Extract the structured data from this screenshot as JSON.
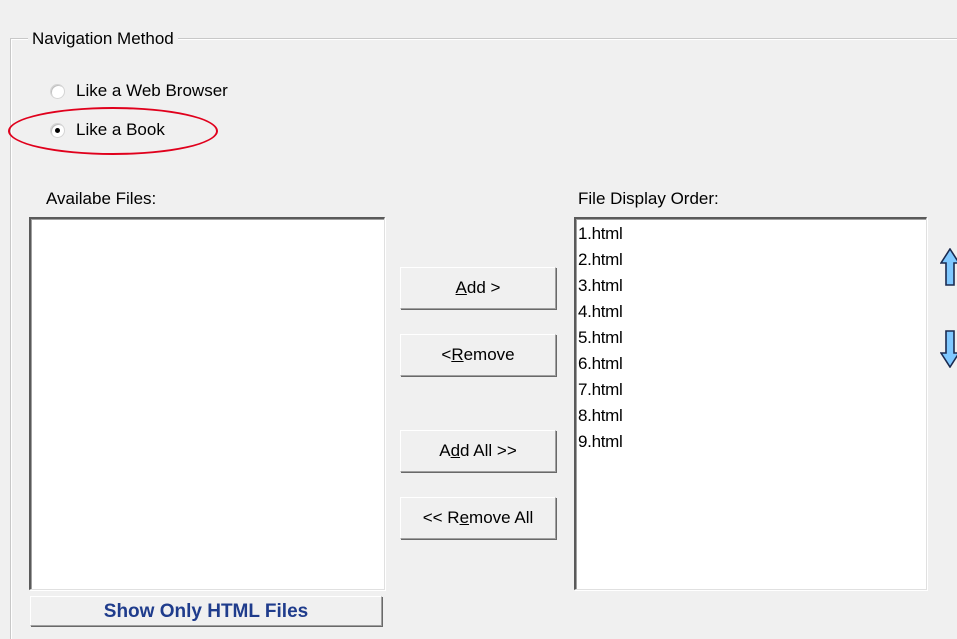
{
  "navigation": {
    "group_label": "Navigation Method",
    "options": [
      {
        "label": "Like a Web Browser",
        "checked": false
      },
      {
        "label": "Like a Book",
        "checked": true
      }
    ]
  },
  "available_files": {
    "label": "Availabe Files:",
    "items": []
  },
  "display_order": {
    "label": "File Display Order:",
    "items": [
      "1.html",
      "2.html",
      "3.html",
      "4.html",
      "5.html",
      "6.html",
      "7.html",
      "8.html",
      "9.html"
    ]
  },
  "buttons": {
    "add": {
      "pre": "",
      "key": "A",
      "post": "dd >"
    },
    "remove": {
      "pre": "< ",
      "key": "R",
      "post": "emove"
    },
    "add_all": {
      "pre": "A",
      "key": "d",
      "post": "d All >>"
    },
    "remove_all": {
      "pre": "<< R",
      "key": "e",
      "post": "move All"
    }
  },
  "bottom_button": "Show Only HTML Files",
  "icons": {
    "up": "up-arrow-icon",
    "down": "down-arrow-icon"
  },
  "colors": {
    "highlight": "#e0001c",
    "arrow_fill": "#7fc8ff",
    "arrow_stroke": "#1a2a50",
    "bottom_button_text": "#1f3c8c"
  }
}
